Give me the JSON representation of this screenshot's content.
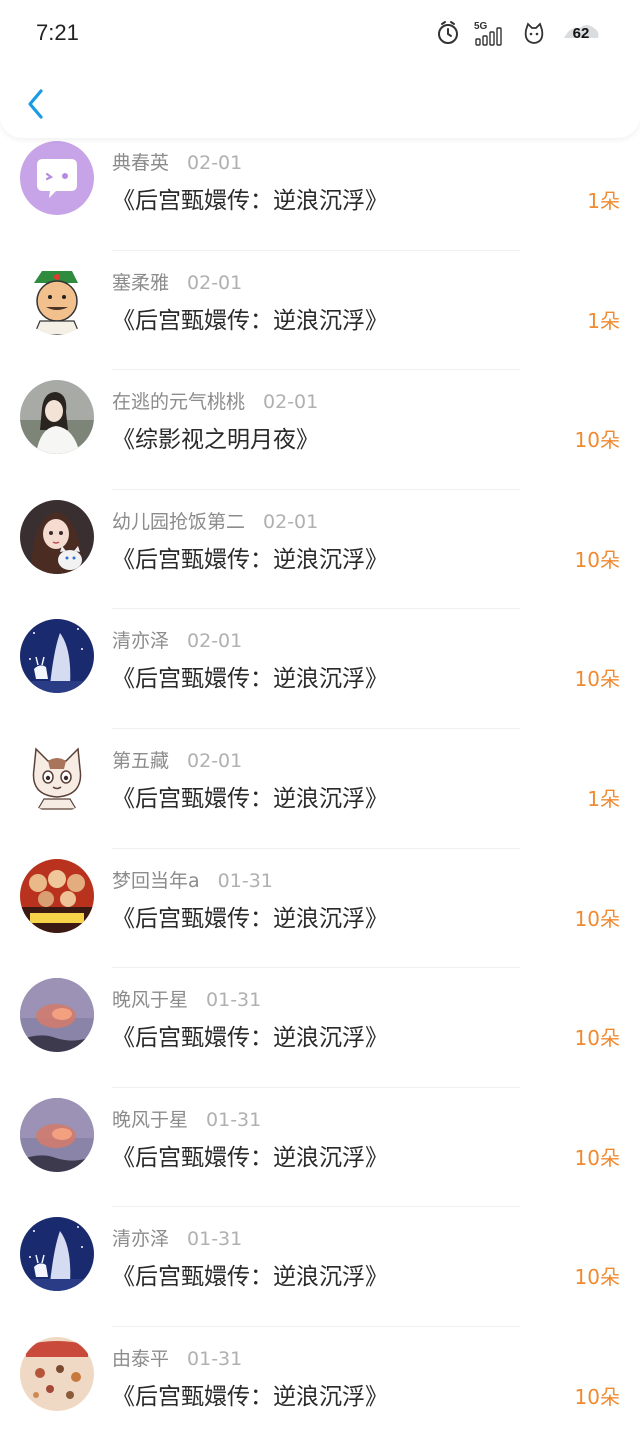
{
  "status_bar": {
    "time": "7:21",
    "network": "5G",
    "battery": "62"
  },
  "list": [
    {
      "name": "典春英",
      "date": "02-01",
      "title": "《后宫甄嬛传：逆浪沉浮》",
      "amount": "1朵",
      "avatar": "speech-bubble-avatar"
    },
    {
      "name": "塞柔雅",
      "date": "02-01",
      "title": "《后宫甄嬛传：逆浪沉浮》",
      "amount": "1朵",
      "avatar": "cartoon-man-avatar"
    },
    {
      "name": "在逃的元气桃桃",
      "date": "02-01",
      "title": "《综影视之明月夜》",
      "amount": "10朵",
      "avatar": "woman-photo-avatar"
    },
    {
      "name": "幼儿园抢饭第二",
      "date": "02-01",
      "title": "《后宫甄嬛传：逆浪沉浮》",
      "amount": "10朵",
      "avatar": "girl-with-cat-avatar"
    },
    {
      "name": "清亦泽",
      "date": "02-01",
      "title": "《后宫甄嬛传：逆浪沉浮》",
      "amount": "10朵",
      "avatar": "night-deer-avatar"
    },
    {
      "name": "第五藏",
      "date": "02-01",
      "title": "《后宫甄嬛传：逆浪沉浮》",
      "amount": "1朵",
      "avatar": "cartoon-cat-avatar"
    },
    {
      "name": "梦回当年a",
      "date": "01-31",
      "title": "《后宫甄嬛传：逆浪沉浮》",
      "amount": "10朵",
      "avatar": "movie-poster-avatar"
    },
    {
      "name": "晚风于星",
      "date": "01-31",
      "title": "《后宫甄嬛传：逆浪沉浮》",
      "amount": "10朵",
      "avatar": "sunset-sky-avatar"
    },
    {
      "name": "晚风于星",
      "date": "01-31",
      "title": "《后宫甄嬛传：逆浪沉浮》",
      "amount": "10朵",
      "avatar": "sunset-sky-avatar"
    },
    {
      "name": "清亦泽",
      "date": "01-31",
      "title": "《后宫甄嬛传：逆浪沉浮》",
      "amount": "10朵",
      "avatar": "night-deer-avatar"
    },
    {
      "name": "由泰平",
      "date": "01-31",
      "title": "《后宫甄嬛传：逆浪沉浮》",
      "amount": "10朵",
      "avatar": "craft-items-avatar"
    }
  ],
  "colors": {
    "accent": "#1a9be6",
    "amount": "#f08a30",
    "name": "#8c8c8c",
    "title": "#2a2a2a"
  }
}
